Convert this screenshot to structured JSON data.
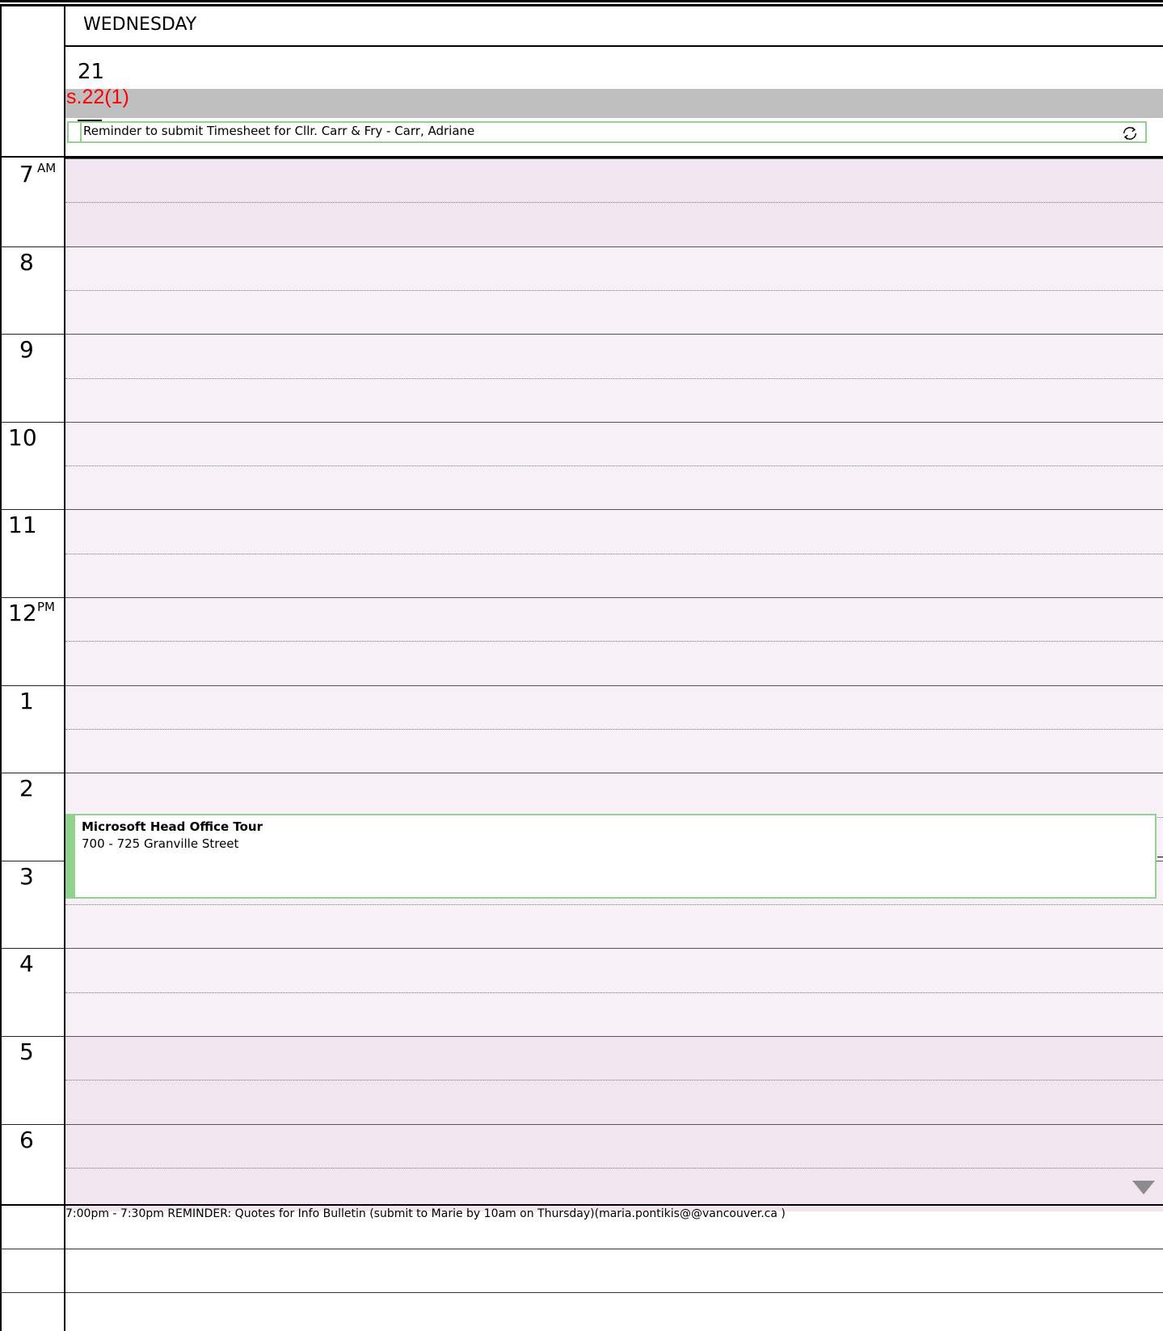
{
  "header": {
    "day_name": "WEDNESDAY",
    "day_number": "21",
    "redaction_label": "s.22(1)"
  },
  "all_day_event": {
    "text": "Reminder to submit Timesheet for Cllr. Carr & Fry - Carr, Adriane",
    "recurring_icon": "recurring-icon"
  },
  "hours": [
    {
      "label": "7",
      "suffix": "AM"
    },
    {
      "label": "8",
      "suffix": ""
    },
    {
      "label": "9",
      "suffix": ""
    },
    {
      "label": "10",
      "suffix": ""
    },
    {
      "label": "11",
      "suffix": ""
    },
    {
      "label": "12",
      "suffix": "PM"
    },
    {
      "label": "1",
      "suffix": ""
    },
    {
      "label": "2",
      "suffix": ""
    },
    {
      "label": "3",
      "suffix": ""
    },
    {
      "label": "4",
      "suffix": ""
    },
    {
      "label": "5",
      "suffix": ""
    },
    {
      "label": "6",
      "suffix": ""
    }
  ],
  "event": {
    "title": "Microsoft Head Office Tour",
    "location": "700  - 725 Granville Street"
  },
  "overflow_indicator": "scroll-down-arrow-icon",
  "footer": {
    "items": [
      "7:00pm - 7:30pm REMINDER: Quotes for Info Bulletin (submit to Marie by 10am on Thursday)(maria.pontikis@@vancouver.ca )"
    ]
  },
  "colors": {
    "off_hours": "#f1e5f1",
    "work_hours": "#f7f0f7",
    "event_accent": "#8fd38f",
    "redaction_text": "#ff0000",
    "all_day_band": "#bfbfbf"
  }
}
